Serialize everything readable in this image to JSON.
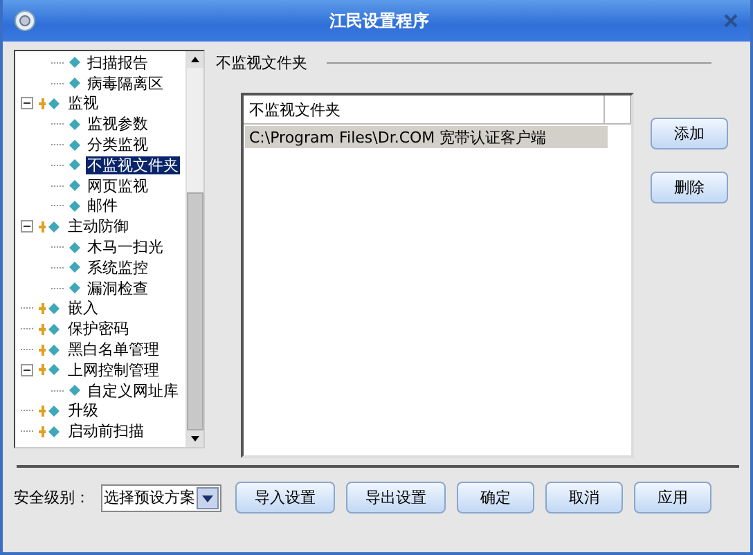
{
  "window": {
    "title": "江民设置程序"
  },
  "tree": {
    "items": [
      {
        "children": [
          {
            "label": "扫描报告",
            "selected": false
          },
          {
            "label": "病毒隔离区",
            "selected": false
          }
        ]
      },
      {
        "label": "监视",
        "expanded": true,
        "selected": false,
        "children": [
          {
            "label": "监视参数",
            "selected": false
          },
          {
            "label": "分类监视",
            "selected": false
          },
          {
            "label": "不监视文件夹",
            "selected": true
          },
          {
            "label": "网页监视",
            "selected": false
          },
          {
            "label": "邮件",
            "selected": false
          }
        ]
      },
      {
        "label": "主动防御",
        "expanded": true,
        "selected": false,
        "children": [
          {
            "label": "木马一扫光",
            "selected": false
          },
          {
            "label": "系统监控",
            "selected": false
          },
          {
            "label": "漏洞检查",
            "selected": false
          }
        ]
      },
      {
        "label": "嵌入",
        "selected": false
      },
      {
        "label": "保护密码",
        "selected": false
      },
      {
        "label": "黑白名单管理",
        "selected": false
      },
      {
        "label": "上网控制管理",
        "expanded": true,
        "selected": false,
        "children": [
          {
            "label": "自定义网址库",
            "selected": false
          }
        ]
      },
      {
        "label": "升级",
        "selected": false
      },
      {
        "label": "启动前扫描",
        "selected": false
      }
    ]
  },
  "section": {
    "title": "不监视文件夹"
  },
  "list": {
    "columns": [
      "不监视文件夹"
    ],
    "rows": [
      {
        "cells": [
          "C:\\Program Files\\Dr.COM 宽带认证客户端"
        ],
        "selected": true
      }
    ]
  },
  "side_buttons": [
    "添加",
    "删除"
  ],
  "footer": {
    "label": "安全级别：",
    "dropdown": "选择预设方案",
    "buttons": [
      "导入设置",
      "导出设置",
      "确定",
      "取消",
      "应用"
    ]
  }
}
